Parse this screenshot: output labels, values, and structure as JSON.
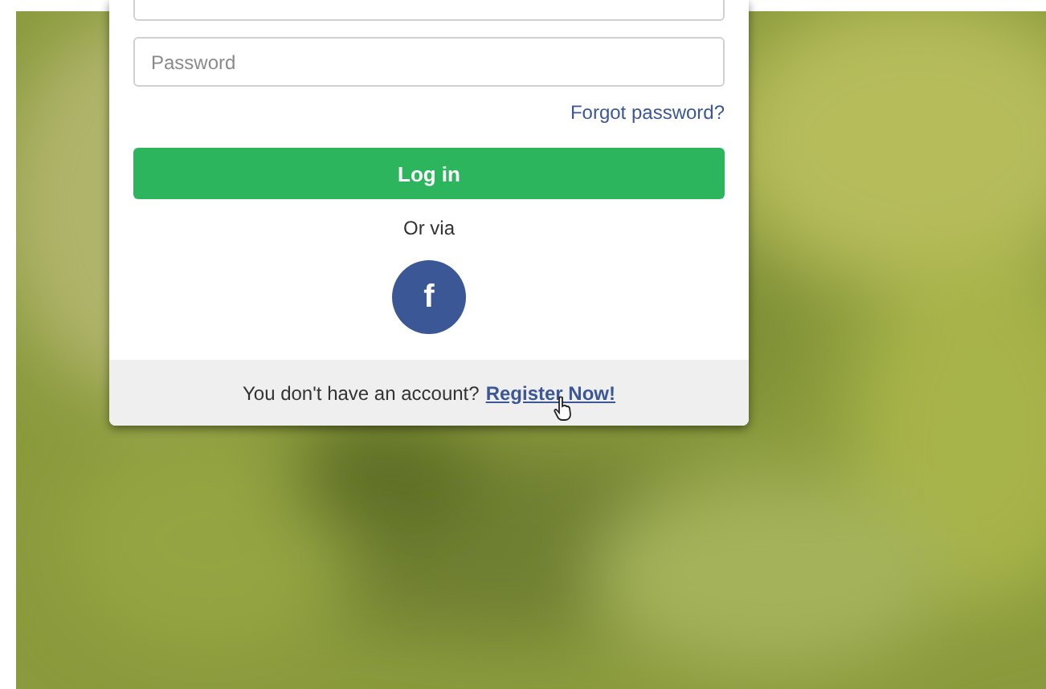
{
  "login_form": {
    "password": {
      "placeholder": "Password"
    },
    "forgot_link": "Forgot password?",
    "login_button": "Log in",
    "divider_text": "Or via",
    "social_buttons": [
      {
        "kind": "facebook",
        "label": "f"
      }
    ]
  },
  "footer": {
    "text": "You don't have an account?",
    "link": "Register Now!"
  }
}
